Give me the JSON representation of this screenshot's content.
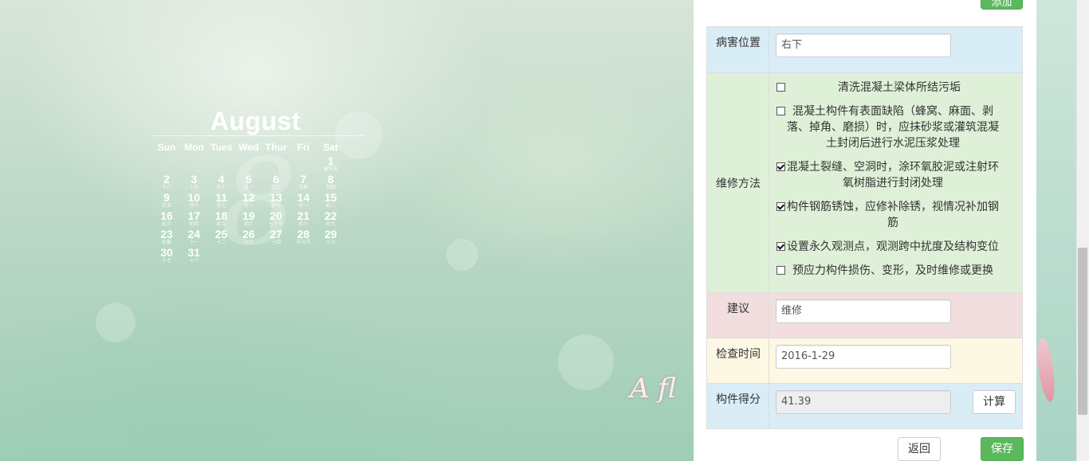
{
  "calendar": {
    "month": "August",
    "big_number": "8",
    "weekdays": [
      "Sun",
      "Mon",
      "Tues",
      "Wed",
      "Thur",
      "Fri",
      "Sat"
    ],
    "days": [
      {
        "d": "1",
        "sub": "建军节",
        "col": 6,
        "row": 0
      },
      {
        "d": "2",
        "sub": "十八",
        "col": 0,
        "row": 1
      },
      {
        "d": "3",
        "sub": "十九",
        "col": 1,
        "row": 1
      },
      {
        "d": "4",
        "sub": "廿十",
        "col": 2,
        "row": 1
      },
      {
        "d": "5",
        "sub": "廿一",
        "col": 3,
        "row": 1
      },
      {
        "d": "6",
        "sub": "廿二",
        "col": 4,
        "row": 1
      },
      {
        "d": "7",
        "sub": "立秋",
        "col": 5,
        "row": 1
      },
      {
        "d": "8",
        "sub": "廿四",
        "col": 6,
        "row": 1
      },
      {
        "d": "9",
        "sub": "廿五",
        "col": 0,
        "row": 2
      },
      {
        "d": "10",
        "sub": "廿六",
        "col": 1,
        "row": 2
      },
      {
        "d": "11",
        "sub": "廿七",
        "col": 2,
        "row": 2
      },
      {
        "d": "12",
        "sub": "廿八",
        "col": 3,
        "row": 2
      },
      {
        "d": "13",
        "sub": "廿九",
        "col": 4,
        "row": 2
      },
      {
        "d": "14",
        "sub": "初一",
        "col": 5,
        "row": 2
      },
      {
        "d": "15",
        "sub": "初二",
        "col": 6,
        "row": 2
      },
      {
        "d": "16",
        "sub": "初三",
        "col": 0,
        "row": 3
      },
      {
        "d": "17",
        "sub": "初四",
        "col": 1,
        "row": 3
      },
      {
        "d": "18",
        "sub": "初五",
        "col": 2,
        "row": 3
      },
      {
        "d": "19",
        "sub": "初六",
        "col": 3,
        "row": 3
      },
      {
        "d": "20",
        "sub": "七夕节",
        "col": 4,
        "row": 3
      },
      {
        "d": "21",
        "sub": "初八",
        "col": 5,
        "row": 3
      },
      {
        "d": "22",
        "sub": "初九",
        "col": 6,
        "row": 3
      },
      {
        "d": "23",
        "sub": "处暑",
        "col": 0,
        "row": 4
      },
      {
        "d": "24",
        "sub": "十一",
        "col": 1,
        "row": 4
      },
      {
        "d": "25",
        "sub": "十二",
        "col": 2,
        "row": 4
      },
      {
        "d": "26",
        "sub": "十三",
        "col": 3,
        "row": 4
      },
      {
        "d": "27",
        "sub": "十四",
        "col": 4,
        "row": 4
      },
      {
        "d": "28",
        "sub": "中元节",
        "col": 5,
        "row": 4
      },
      {
        "d": "29",
        "sub": "十六",
        "col": 6,
        "row": 4
      },
      {
        "d": "30",
        "sub": "十七",
        "col": 0,
        "row": 5
      },
      {
        "d": "31",
        "sub": "十八",
        "col": 1,
        "row": 5
      }
    ]
  },
  "wallpaper_script": "A fl",
  "top_button_label": "添加",
  "form": {
    "location": {
      "label": "病害位置",
      "value": "右下"
    },
    "repair": {
      "label": "维修方法",
      "options": [
        {
          "text": "清洗混凝土梁体所结污垢",
          "checked": false
        },
        {
          "text": "混凝土构件有表面缺陷（蜂窝、麻面、剥落、掉角、磨损）时，应抹砂浆或灌筑混凝土封闭后进行水泥压浆处理",
          "checked": false
        },
        {
          "text": "混凝土裂缝、空洞时，涂环氧胶泥或注射环氧树脂进行封闭处理",
          "checked": true
        },
        {
          "text": "构件钢筋锈蚀，应修补除锈，视情况补加钢筋",
          "checked": true
        },
        {
          "text": "设置永久观测点，观测跨中扰度及结构变位",
          "checked": true
        },
        {
          "text": "预应力构件损伤、变形，及时维修或更换",
          "checked": false
        }
      ]
    },
    "advice": {
      "label": "建议",
      "value": "维修"
    },
    "inspect_time": {
      "label": "检查时间",
      "value": "2016-1-29"
    },
    "score": {
      "label": "构件得分",
      "value": "41.39",
      "calc_label": "计算"
    }
  },
  "buttons": {
    "back": "返回",
    "save": "保存"
  },
  "colors": {
    "success": "#5cb85c",
    "info_row": "#d9edf7",
    "success_row": "#dff0d8",
    "danger_row": "#f2dede",
    "warning_row": "#fcf8e3"
  }
}
